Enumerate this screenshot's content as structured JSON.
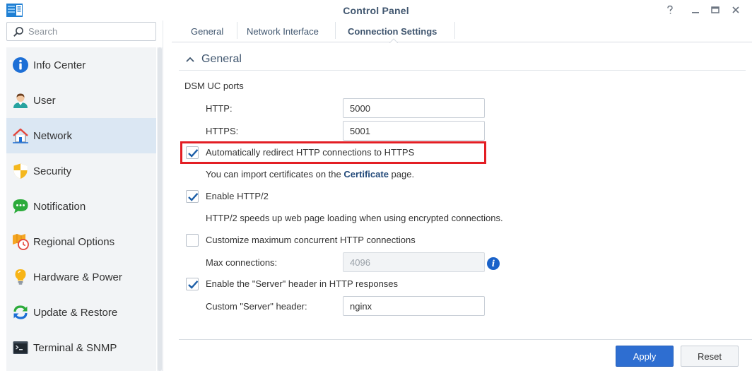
{
  "window": {
    "title": "Control Panel",
    "controls": [
      "help",
      "minimize",
      "maximize",
      "close"
    ]
  },
  "search": {
    "placeholder": "Search",
    "value": ""
  },
  "sidebar": {
    "items": [
      {
        "label": "Info Center",
        "icon": "info-icon"
      },
      {
        "label": "User",
        "icon": "user-icon"
      },
      {
        "label": "Network",
        "icon": "network-icon",
        "active": true
      },
      {
        "label": "Security",
        "icon": "shield-icon"
      },
      {
        "label": "Notification",
        "icon": "chat-bubble-icon"
      },
      {
        "label": "Regional Options",
        "icon": "map-clock-icon"
      },
      {
        "label": "Hardware & Power",
        "icon": "lightbulb-icon"
      },
      {
        "label": "Update & Restore",
        "icon": "refresh-icon"
      },
      {
        "label": "Terminal & SNMP",
        "icon": "terminal-icon"
      }
    ]
  },
  "tabs": [
    {
      "label": "General"
    },
    {
      "label": "Network Interface"
    },
    {
      "label": "Connection Settings",
      "active": true
    }
  ],
  "section": {
    "title": "General",
    "ports_heading": "DSM UC ports",
    "http_label": "HTTP:",
    "http_value": "5000",
    "https_label": "HTTPS:",
    "https_value": "5001",
    "redirect_label": "Automatically redirect HTTP connections to HTTPS",
    "redirect_checked": true,
    "cert_text_before": "You can import certificates on the ",
    "cert_link": "Certificate",
    "cert_text_after": " page.",
    "http2_label": "Enable HTTP/2",
    "http2_checked": true,
    "http2_desc": "HTTP/2 speeds up web page loading when using encrypted connections.",
    "maxconn_label": "Customize maximum concurrent HTTP connections",
    "maxconn_checked": false,
    "maxconn_field_label": "Max connections:",
    "maxconn_value": "4096",
    "server_header_label": "Enable the \"Server\" header in HTTP responses",
    "server_header_checked": true,
    "custom_server_label": "Custom \"Server\" header:",
    "custom_server_value": "nginx"
  },
  "footer": {
    "apply": "Apply",
    "reset": "Reset"
  },
  "colors": {
    "accent": "#2e6ed1",
    "highlight_box": "#e31e24",
    "active_nav": "#dbe7f3",
    "title_text": "#40566f"
  }
}
